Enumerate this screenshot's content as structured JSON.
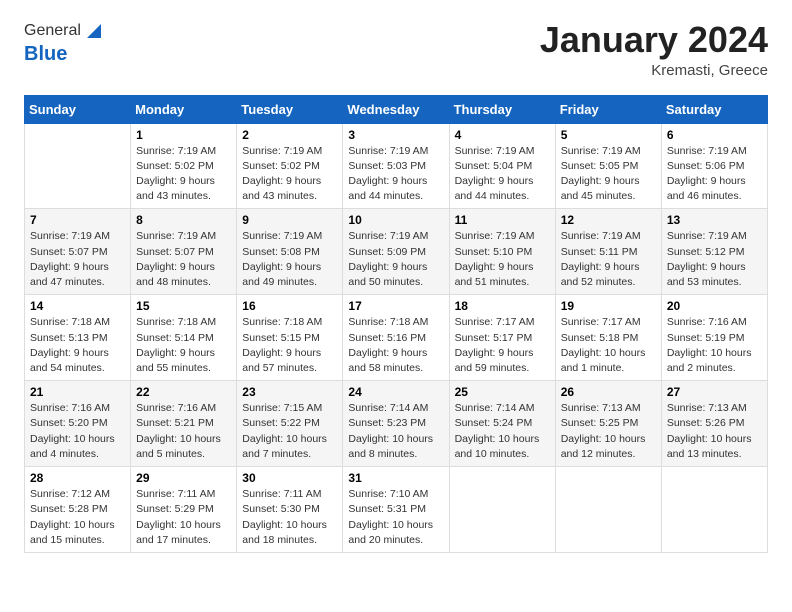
{
  "header": {
    "logo_general": "General",
    "logo_blue": "Blue",
    "month_title": "January 2024",
    "location": "Kremasti, Greece"
  },
  "calendar": {
    "columns": [
      "Sunday",
      "Monday",
      "Tuesday",
      "Wednesday",
      "Thursday",
      "Friday",
      "Saturday"
    ],
    "weeks": [
      [
        {
          "day": "",
          "sunrise": "",
          "sunset": "",
          "daylight": ""
        },
        {
          "day": "1",
          "sunrise": "Sunrise: 7:19 AM",
          "sunset": "Sunset: 5:02 PM",
          "daylight": "Daylight: 9 hours and 43 minutes."
        },
        {
          "day": "2",
          "sunrise": "Sunrise: 7:19 AM",
          "sunset": "Sunset: 5:02 PM",
          "daylight": "Daylight: 9 hours and 43 minutes."
        },
        {
          "day": "3",
          "sunrise": "Sunrise: 7:19 AM",
          "sunset": "Sunset: 5:03 PM",
          "daylight": "Daylight: 9 hours and 44 minutes."
        },
        {
          "day": "4",
          "sunrise": "Sunrise: 7:19 AM",
          "sunset": "Sunset: 5:04 PM",
          "daylight": "Daylight: 9 hours and 44 minutes."
        },
        {
          "day": "5",
          "sunrise": "Sunrise: 7:19 AM",
          "sunset": "Sunset: 5:05 PM",
          "daylight": "Daylight: 9 hours and 45 minutes."
        },
        {
          "day": "6",
          "sunrise": "Sunrise: 7:19 AM",
          "sunset": "Sunset: 5:06 PM",
          "daylight": "Daylight: 9 hours and 46 minutes."
        }
      ],
      [
        {
          "day": "7",
          "sunrise": "Sunrise: 7:19 AM",
          "sunset": "Sunset: 5:07 PM",
          "daylight": "Daylight: 9 hours and 47 minutes."
        },
        {
          "day": "8",
          "sunrise": "Sunrise: 7:19 AM",
          "sunset": "Sunset: 5:07 PM",
          "daylight": "Daylight: 9 hours and 48 minutes."
        },
        {
          "day": "9",
          "sunrise": "Sunrise: 7:19 AM",
          "sunset": "Sunset: 5:08 PM",
          "daylight": "Daylight: 9 hours and 49 minutes."
        },
        {
          "day": "10",
          "sunrise": "Sunrise: 7:19 AM",
          "sunset": "Sunset: 5:09 PM",
          "daylight": "Daylight: 9 hours and 50 minutes."
        },
        {
          "day": "11",
          "sunrise": "Sunrise: 7:19 AM",
          "sunset": "Sunset: 5:10 PM",
          "daylight": "Daylight: 9 hours and 51 minutes."
        },
        {
          "day": "12",
          "sunrise": "Sunrise: 7:19 AM",
          "sunset": "Sunset: 5:11 PM",
          "daylight": "Daylight: 9 hours and 52 minutes."
        },
        {
          "day": "13",
          "sunrise": "Sunrise: 7:19 AM",
          "sunset": "Sunset: 5:12 PM",
          "daylight": "Daylight: 9 hours and 53 minutes."
        }
      ],
      [
        {
          "day": "14",
          "sunrise": "Sunrise: 7:18 AM",
          "sunset": "Sunset: 5:13 PM",
          "daylight": "Daylight: 9 hours and 54 minutes."
        },
        {
          "day": "15",
          "sunrise": "Sunrise: 7:18 AM",
          "sunset": "Sunset: 5:14 PM",
          "daylight": "Daylight: 9 hours and 55 minutes."
        },
        {
          "day": "16",
          "sunrise": "Sunrise: 7:18 AM",
          "sunset": "Sunset: 5:15 PM",
          "daylight": "Daylight: 9 hours and 57 minutes."
        },
        {
          "day": "17",
          "sunrise": "Sunrise: 7:18 AM",
          "sunset": "Sunset: 5:16 PM",
          "daylight": "Daylight: 9 hours and 58 minutes."
        },
        {
          "day": "18",
          "sunrise": "Sunrise: 7:17 AM",
          "sunset": "Sunset: 5:17 PM",
          "daylight": "Daylight: 9 hours and 59 minutes."
        },
        {
          "day": "19",
          "sunrise": "Sunrise: 7:17 AM",
          "sunset": "Sunset: 5:18 PM",
          "daylight": "Daylight: 10 hours and 1 minute."
        },
        {
          "day": "20",
          "sunrise": "Sunrise: 7:16 AM",
          "sunset": "Sunset: 5:19 PM",
          "daylight": "Daylight: 10 hours and 2 minutes."
        }
      ],
      [
        {
          "day": "21",
          "sunrise": "Sunrise: 7:16 AM",
          "sunset": "Sunset: 5:20 PM",
          "daylight": "Daylight: 10 hours and 4 minutes."
        },
        {
          "day": "22",
          "sunrise": "Sunrise: 7:16 AM",
          "sunset": "Sunset: 5:21 PM",
          "daylight": "Daylight: 10 hours and 5 minutes."
        },
        {
          "day": "23",
          "sunrise": "Sunrise: 7:15 AM",
          "sunset": "Sunset: 5:22 PM",
          "daylight": "Daylight: 10 hours and 7 minutes."
        },
        {
          "day": "24",
          "sunrise": "Sunrise: 7:14 AM",
          "sunset": "Sunset: 5:23 PM",
          "daylight": "Daylight: 10 hours and 8 minutes."
        },
        {
          "day": "25",
          "sunrise": "Sunrise: 7:14 AM",
          "sunset": "Sunset: 5:24 PM",
          "daylight": "Daylight: 10 hours and 10 minutes."
        },
        {
          "day": "26",
          "sunrise": "Sunrise: 7:13 AM",
          "sunset": "Sunset: 5:25 PM",
          "daylight": "Daylight: 10 hours and 12 minutes."
        },
        {
          "day": "27",
          "sunrise": "Sunrise: 7:13 AM",
          "sunset": "Sunset: 5:26 PM",
          "daylight": "Daylight: 10 hours and 13 minutes."
        }
      ],
      [
        {
          "day": "28",
          "sunrise": "Sunrise: 7:12 AM",
          "sunset": "Sunset: 5:28 PM",
          "daylight": "Daylight: 10 hours and 15 minutes."
        },
        {
          "day": "29",
          "sunrise": "Sunrise: 7:11 AM",
          "sunset": "Sunset: 5:29 PM",
          "daylight": "Daylight: 10 hours and 17 minutes."
        },
        {
          "day": "30",
          "sunrise": "Sunrise: 7:11 AM",
          "sunset": "Sunset: 5:30 PM",
          "daylight": "Daylight: 10 hours and 18 minutes."
        },
        {
          "day": "31",
          "sunrise": "Sunrise: 7:10 AM",
          "sunset": "Sunset: 5:31 PM",
          "daylight": "Daylight: 10 hours and 20 minutes."
        },
        {
          "day": "",
          "sunrise": "",
          "sunset": "",
          "daylight": ""
        },
        {
          "day": "",
          "sunrise": "",
          "sunset": "",
          "daylight": ""
        },
        {
          "day": "",
          "sunrise": "",
          "sunset": "",
          "daylight": ""
        }
      ]
    ]
  }
}
